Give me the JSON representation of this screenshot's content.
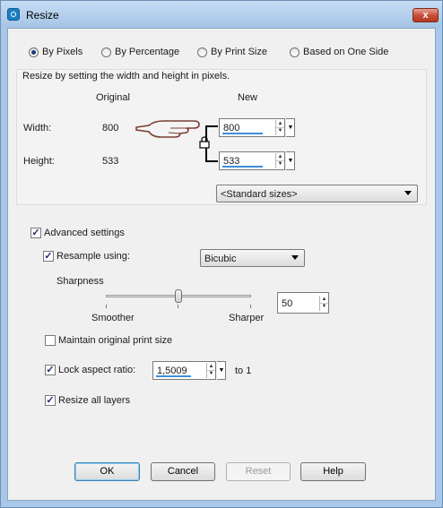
{
  "window": {
    "title": "Resize",
    "close_label": "x"
  },
  "mode": {
    "options": [
      {
        "label": "By Pixels",
        "selected": true
      },
      {
        "label": "By Percentage",
        "selected": false
      },
      {
        "label": "By Print Size",
        "selected": false
      },
      {
        "label": "Based on One Side",
        "selected": false
      }
    ]
  },
  "pixels": {
    "description": "Resize by setting the width and height in pixels.",
    "original_header": "Original",
    "new_header": "New",
    "width_label": "Width:",
    "height_label": "Height:",
    "width_original": "800",
    "height_original": "533",
    "width_new": "800",
    "height_new": "533",
    "standard_sizes": "<Standard sizes>"
  },
  "advanced": {
    "advanced_label": "Advanced settings",
    "advanced_checked": true,
    "resample_label": "Resample using:",
    "resample_checked": true,
    "resample_method": "Bicubic",
    "sharpness_label": "Sharpness",
    "smoother_label": "Smoother",
    "sharper_label": "Sharper",
    "sharpness_value": "50",
    "sharpness_level": 0.5,
    "maintain_print_label": "Maintain original print size",
    "maintain_print_checked": false,
    "lock_aspect_label": "Lock aspect ratio:",
    "lock_aspect_checked": true,
    "aspect_value": "1,5009",
    "to_one_label": "to 1",
    "resize_layers_label": "Resize all layers",
    "resize_layers_checked": true
  },
  "buttons": {
    "ok": "OK",
    "cancel": "Cancel",
    "reset": "Reset",
    "help": "Help"
  },
  "colors": {
    "accent": "#3f8fd8",
    "window_frame": "#a9c7e8",
    "close": "#c74a32"
  }
}
